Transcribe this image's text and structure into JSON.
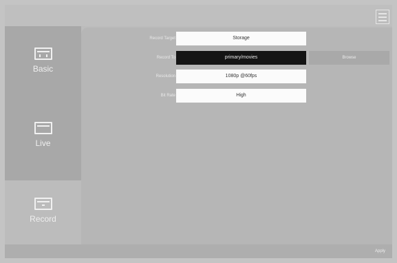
{
  "sidebar": {
    "items": [
      {
        "label": "Basic",
        "icon": "camera-settings-icon"
      },
      {
        "label": "Live",
        "icon": "monitor-icon"
      },
      {
        "label": "Record",
        "icon": "record-icon"
      }
    ]
  },
  "form": {
    "record_target": {
      "label": "Record Target",
      "value": "Storage"
    },
    "record_to": {
      "label": "Record To",
      "value": "primary/movies",
      "browse_label": "Browse"
    },
    "resolution": {
      "label": "Resolution",
      "value": "1080p @60fps"
    },
    "bit_rate": {
      "label": "Bit Rate",
      "value": "High"
    }
  },
  "footer": {
    "apply_label": "Apply"
  },
  "colors": {
    "panel": "#b6b6b6",
    "active_nav": "#a8a8a8",
    "field_bg": "#fbfbfb",
    "selected_field_bg": "#141414"
  }
}
